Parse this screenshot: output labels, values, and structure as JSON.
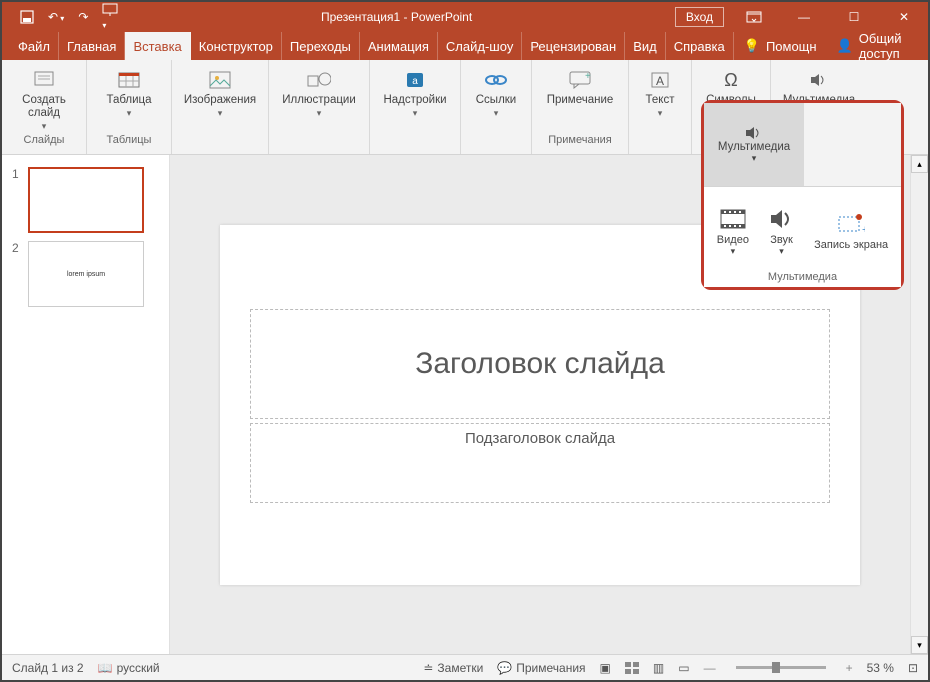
{
  "titlebar": {
    "title": "Презентация1 - PowerPoint",
    "login": "Вход"
  },
  "tabs": {
    "file": "Файл",
    "home": "Главная",
    "insert": "Вставка",
    "design": "Конструктор",
    "transitions": "Переходы",
    "animation": "Анимация",
    "slideshow": "Слайд-шоу",
    "review": "Рецензирован",
    "view": "Вид",
    "help": "Справка",
    "tell_me": "Помощн",
    "share": "Общий доступ"
  },
  "ribbon": {
    "new_slide": "Создать слайд",
    "slides_group": "Слайды",
    "table": "Таблица",
    "tables_group": "Таблицы",
    "images": "Изображения",
    "illustrations": "Иллюстрации",
    "addins": "Надстройки",
    "links": "Ссылки",
    "comment": "Примечание",
    "comments_group": "Примечания",
    "text": "Текст",
    "symbols": "Символы",
    "multimedia": "Мультимедиа"
  },
  "mm": {
    "video": "Видео",
    "audio": "Звук",
    "screenrec": "Запись экрана",
    "group": "Мультимедиа"
  },
  "slides": {
    "s1": "1",
    "s2": "2",
    "s2_text": "lorem ipsum"
  },
  "placeholders": {
    "title": "Заголовок слайда",
    "subtitle": "Подзаголовок слайда"
  },
  "status": {
    "slide_of": "Слайд 1 из 2",
    "lang": "русский",
    "notes": "Заметки",
    "comments": "Примечания",
    "zoom": "53 %"
  }
}
